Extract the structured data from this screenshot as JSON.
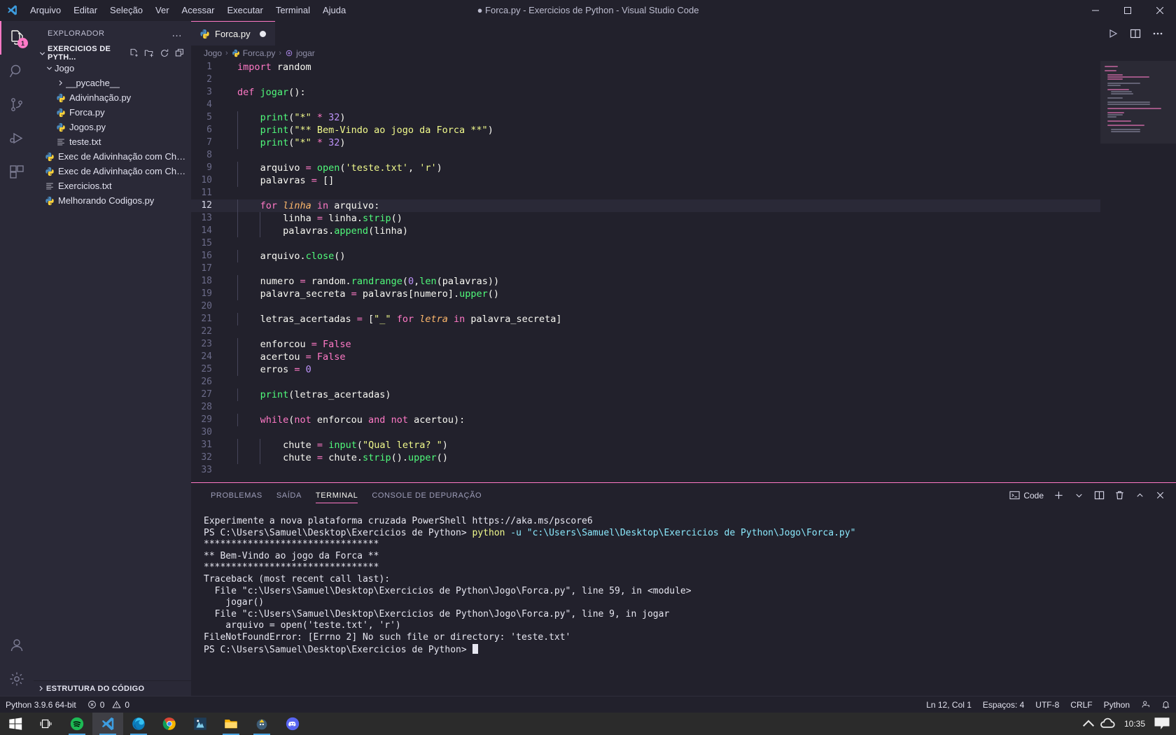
{
  "window": {
    "title": "● Forca.py - Exercicios de Python - Visual Studio Code",
    "menus": [
      "Arquivo",
      "Editar",
      "Seleção",
      "Ver",
      "Acessar",
      "Executar",
      "Terminal",
      "Ajuda"
    ],
    "controls": {
      "minimize": "minimize-icon",
      "maximize": "maximize-icon",
      "close": "close-icon"
    }
  },
  "activitybar": {
    "items": [
      {
        "name": "explorer",
        "icon": "files-icon",
        "badge": "1",
        "active": true
      },
      {
        "name": "search",
        "icon": "search-icon",
        "badge": "",
        "active": false
      },
      {
        "name": "source-control",
        "icon": "source-control-icon",
        "badge": "",
        "active": false
      },
      {
        "name": "run-debug",
        "icon": "run-debug-icon",
        "badge": "",
        "active": false
      },
      {
        "name": "extensions",
        "icon": "extensions-icon",
        "badge": "",
        "active": false
      }
    ],
    "bottom": [
      {
        "name": "accounts",
        "icon": "account-icon"
      },
      {
        "name": "manage",
        "icon": "gear-icon"
      }
    ]
  },
  "sidebar": {
    "title": "EXPLORADOR",
    "more_label": "…",
    "root": "EXERCICIOS DE PYTH...",
    "actions": [
      "new-file-icon",
      "new-folder-icon",
      "refresh-icon",
      "collapse-all-icon"
    ],
    "items": [
      {
        "label": "Jogo",
        "icon": "folder-open",
        "indent": 1,
        "arrow": "down"
      },
      {
        "label": "__pycache__",
        "icon": "folder",
        "indent": 2,
        "arrow": "right"
      },
      {
        "label": "Adivinhação.py",
        "icon": "python",
        "indent": 2,
        "arrow": ""
      },
      {
        "label": "Forca.py",
        "icon": "python",
        "indent": 2,
        "arrow": ""
      },
      {
        "label": "Jogos.py",
        "icon": "python",
        "indent": 2,
        "arrow": ""
      },
      {
        "label": "teste.txt",
        "icon": "text",
        "indent": 2,
        "arrow": ""
      },
      {
        "label": "Exec de Adivinhação com Chances...",
        "icon": "python",
        "indent": 1,
        "arrow": ""
      },
      {
        "label": "Exec de Adivinhação com Chances...",
        "icon": "python",
        "indent": 1,
        "arrow": ""
      },
      {
        "label": "Exercicios.txt",
        "icon": "text",
        "indent": 1,
        "arrow": ""
      },
      {
        "label": "Melhorando Codigos.py",
        "icon": "python",
        "indent": 1,
        "arrow": ""
      }
    ],
    "footer": "ESTRUTURA DO CÓDIGO"
  },
  "editor": {
    "tab": {
      "label": "Forca.py",
      "icon": "python-icon",
      "dirty": true
    },
    "actions": [
      "run-python-file-icon",
      "split-editor-icon",
      "more-actions-icon"
    ],
    "breadcrumb": [
      "Jogo",
      "Forca.py",
      "jogar"
    ],
    "current_line": 12
  },
  "panel": {
    "tabs": [
      {
        "label": "PROBLEMAS",
        "active": false
      },
      {
        "label": "SAÍDA",
        "active": false
      },
      {
        "label": "TERMINAL",
        "active": true
      },
      {
        "label": "CONSOLE DE DEPURAÇÃO",
        "active": false
      }
    ],
    "terminal_name": "Code",
    "actions": [
      "new-terminal-icon",
      "terminal-dropdown-icon",
      "split-terminal-icon",
      "kill-terminal-icon",
      "maximize-panel-icon",
      "close-panel-icon"
    ],
    "lines": [
      {
        "text": "Experimente a nova plataforma cruzada PowerShell https://aka.ms/pscore6",
        "color": "white"
      },
      {
        "text": "",
        "color": "white"
      },
      {
        "text": "PS C:\\Users\\Samuel\\Desktop\\Exercicios de Python> ",
        "color": "white",
        "inline": [
          {
            "text": "python",
            "color": "yellow"
          },
          {
            "text": " -u ",
            "color": "cyan"
          },
          {
            "text": "\"c:\\Users\\Samuel\\Desktop\\Exercicios de Python\\Jogo\\Forca.py\"",
            "color": "cyan"
          }
        ]
      },
      {
        "text": "********************************",
        "color": "white"
      },
      {
        "text": "** Bem-Vindo ao jogo da Forca **",
        "color": "white"
      },
      {
        "text": "********************************",
        "color": "white"
      },
      {
        "text": "Traceback (most recent call last):",
        "color": "white"
      },
      {
        "text": "  File \"c:\\Users\\Samuel\\Desktop\\Exercicios de Python\\Jogo\\Forca.py\", line 59, in <module>",
        "color": "white"
      },
      {
        "text": "    jogar()",
        "color": "white"
      },
      {
        "text": "  File \"c:\\Users\\Samuel\\Desktop\\Exercicios de Python\\Jogo\\Forca.py\", line 9, in jogar",
        "color": "white"
      },
      {
        "text": "    arquivo = open('teste.txt', 'r')",
        "color": "white"
      },
      {
        "text": "FileNotFoundError: [Errno 2] No such file or directory: 'teste.txt'",
        "color": "white"
      },
      {
        "text": "PS C:\\Users\\Samuel\\Desktop\\Exercicios de Python> ",
        "color": "white",
        "cursor": true
      }
    ]
  },
  "statusbar": {
    "left": [
      {
        "label": "Python 3.9.6 64-bit",
        "icon": ""
      },
      {
        "label": "0",
        "icon": "error-icon"
      },
      {
        "label": "0",
        "icon": "warning-icon"
      }
    ],
    "right": [
      {
        "label": "Ln 12, Col 1",
        "icon": ""
      },
      {
        "label": "Espaços: 4",
        "icon": ""
      },
      {
        "label": "UTF-8",
        "icon": ""
      },
      {
        "label": "CRLF",
        "icon": ""
      },
      {
        "label": "Python",
        "icon": ""
      },
      {
        "label": "",
        "icon": "feedback-icon"
      },
      {
        "label": "",
        "icon": "bell-icon"
      }
    ]
  },
  "taskbar": {
    "items": [
      {
        "name": "start-button",
        "icon": "windows-logo"
      },
      {
        "name": "task-view",
        "icon": "task-view-icon"
      },
      {
        "name": "spotify",
        "icon": "spotify-icon"
      },
      {
        "name": "vscode",
        "icon": "vscode-icon"
      },
      {
        "name": "edge",
        "icon": "edge-icon"
      },
      {
        "name": "chrome",
        "icon": "chrome-icon"
      },
      {
        "name": "krita",
        "icon": "krita-icon"
      },
      {
        "name": "file-explorer",
        "icon": "folder-icon"
      },
      {
        "name": "app-8",
        "icon": "app-icon"
      },
      {
        "name": "discord",
        "icon": "discord-icon"
      }
    ],
    "clock": "10:35",
    "tray": [
      "chevron-up-icon",
      "onedrive-icon"
    ]
  },
  "code": {
    "lines": [
      {
        "n": 1,
        "t": "import random"
      },
      {
        "n": 2,
        "t": ""
      },
      {
        "n": 3,
        "t": "def jogar():"
      },
      {
        "n": 4,
        "t": ""
      },
      {
        "n": 5,
        "t": "    print(\"*\" * 32)"
      },
      {
        "n": 6,
        "t": "    print(\"** Bem-Vindo ao jogo da Forca **\")"
      },
      {
        "n": 7,
        "t": "    print(\"*\" * 32)"
      },
      {
        "n": 8,
        "t": ""
      },
      {
        "n": 9,
        "t": "    arquivo = open('teste.txt', 'r')"
      },
      {
        "n": 10,
        "t": "    palavras = []"
      },
      {
        "n": 11,
        "t": ""
      },
      {
        "n": 12,
        "t": "    for linha in arquivo:"
      },
      {
        "n": 13,
        "t": "        linha = linha.strip()"
      },
      {
        "n": 14,
        "t": "        palavras.append(linha)"
      },
      {
        "n": 15,
        "t": ""
      },
      {
        "n": 16,
        "t": "    arquivo.close()"
      },
      {
        "n": 17,
        "t": ""
      },
      {
        "n": 18,
        "t": "    numero = random.randrange(0,len(palavras))"
      },
      {
        "n": 19,
        "t": "    palavra_secreta = palavras[numero].upper()"
      },
      {
        "n": 20,
        "t": ""
      },
      {
        "n": 21,
        "t": "    letras_acertadas = [\"_\" for letra in palavra_secreta]"
      },
      {
        "n": 22,
        "t": ""
      },
      {
        "n": 23,
        "t": "    enforcou = False"
      },
      {
        "n": 24,
        "t": "    acertou = False"
      },
      {
        "n": 25,
        "t": "    erros = 0"
      },
      {
        "n": 26,
        "t": ""
      },
      {
        "n": 27,
        "t": "    print(letras_acertadas)"
      },
      {
        "n": 28,
        "t": ""
      },
      {
        "n": 29,
        "t": "    while(not enforcou and not acertou):"
      },
      {
        "n": 30,
        "t": ""
      },
      {
        "n": 31,
        "t": "        chute = input(\"Qual letra? \")"
      },
      {
        "n": 32,
        "t": "        chute = chute.strip().upper()"
      },
      {
        "n": 33,
        "t": ""
      }
    ]
  }
}
